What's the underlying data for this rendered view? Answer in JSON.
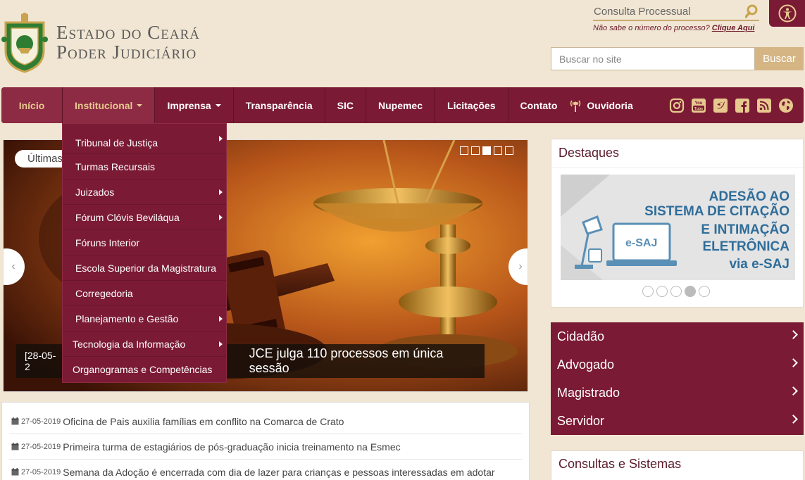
{
  "brand": {
    "line1": "Estado do Ceará",
    "line2": "Poder Judiciário"
  },
  "consulta": {
    "placeholder": "Consulta Processual",
    "hint_text": "Não sabe o número do processo? ",
    "hint_link": "Clique Aqui"
  },
  "site_search": {
    "placeholder": "Buscar no site",
    "button": "Buscar"
  },
  "nav": {
    "items": [
      {
        "label": "Início"
      },
      {
        "label": "Institucional"
      },
      {
        "label": "Imprensa"
      },
      {
        "label": "Transparência"
      },
      {
        "label": "SIC"
      },
      {
        "label": "Nupemec"
      },
      {
        "label": "Licitações"
      },
      {
        "label": "Contato"
      },
      {
        "label": "Ouvidoria"
      }
    ],
    "socials": [
      "instagram-icon",
      "youtube-icon",
      "twitter-icon",
      "facebook-icon",
      "rss-icon",
      "globe-icon"
    ]
  },
  "dropdown": {
    "items": [
      {
        "label": "Tribunal de Justiça",
        "submenu": true
      },
      {
        "label": "Turmas Recursais",
        "submenu": false
      },
      {
        "label": "Juizados",
        "submenu": true
      },
      {
        "label": "Fórum Clóvis Beviláqua",
        "submenu": true
      },
      {
        "label": "Fóruns Interior",
        "submenu": false
      },
      {
        "label": "Escola Superior da Magistratura",
        "submenu": false
      },
      {
        "label": "Corregedoria",
        "submenu": false
      },
      {
        "label": "Planejamento e Gestão",
        "submenu": true
      },
      {
        "label": "Tecnologia da Informação",
        "submenu": true
      },
      {
        "label": "Organogramas e Competências",
        "submenu": false
      }
    ]
  },
  "carousel": {
    "badge": "Últimas",
    "caption_date": "[28-05-2",
    "caption_text": "JCE julga 110 processos em única sessão",
    "prev": "‹",
    "next": "›",
    "active_slide": 3,
    "slide_count": 5
  },
  "news": [
    {
      "date": "27-05-2019",
      "title": "Oficina de Pais auxilia famílias em conflito na Comarca de Crato"
    },
    {
      "date": "27-05-2019",
      "title": "Primeira turma de estagiários de pós-graduação inicia treinamento na Esmec"
    },
    {
      "date": "27-05-2019",
      "title": "Semana da Adoção é encerrada com dia de lazer para crianças e pessoas interessadas em adotar"
    }
  ],
  "destaques": {
    "title": "Destaques",
    "banner_lines": [
      "ADESÃO AO",
      "SISTEMA DE CITAÇÃO",
      "E INTIMAÇÃO",
      "ELETRÔNICA",
      "via e-SAJ"
    ],
    "banner_screen_text": "e-SAJ",
    "active_dot": 4,
    "dot_count": 5
  },
  "side_menu": {
    "items": [
      {
        "label": "Cidadão"
      },
      {
        "label": "Advogado"
      },
      {
        "label": "Magistrado"
      },
      {
        "label": "Servidor"
      }
    ]
  },
  "consultas": {
    "title": "Consultas e Sistemas"
  },
  "colors": {
    "wine": "#7b1a35",
    "gold": "#d5b583",
    "background": "#f1e6d3"
  }
}
